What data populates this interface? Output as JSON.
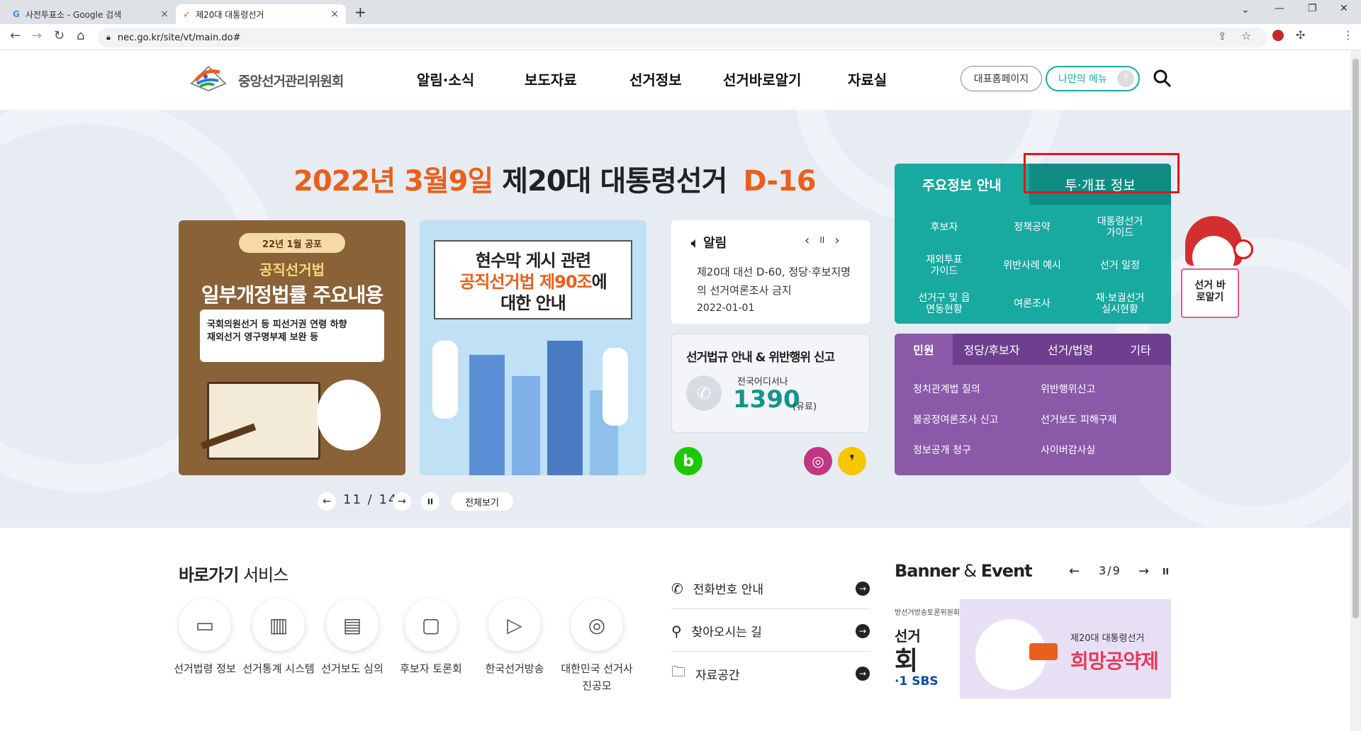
{
  "browser": {
    "tabs": [
      {
        "title": "사전투표소 - Google 검색",
        "favicon": "G",
        "close": "×"
      },
      {
        "title": "제20대 대통령선거",
        "favicon": "nec-icon",
        "close": "×"
      }
    ],
    "new_tab": "+",
    "url": "nec.go.kr/site/vt/main.do#",
    "window_controls": [
      "⌄",
      "—",
      "❐",
      "✕"
    ]
  },
  "header": {
    "logo_text": "중앙선거관리위원회",
    "nav": [
      "알림·소식",
      "보도자료",
      "선거정보",
      "선거바로알기",
      "자료실"
    ],
    "home_button": "대표홈페이지",
    "my_menu_button": "나만의 메뉴",
    "my_menu_badge": "?"
  },
  "hero": {
    "dday_date": "2022년 3월9일",
    "dday_title": "제20대 대통령선거",
    "dday_count": "D-16",
    "banner1": {
      "badge": "22년 1월 공포",
      "subtitle": "공직선거법",
      "title": "일부개정법률 주요내용",
      "box_line1": "국회의원선거 등 피선거권 연령 하향",
      "box_line2": "재외선거 영구명부제 보완 등"
    },
    "banner2": {
      "line1": "현수막 게시 관련",
      "line2": "공직선거법 제90조",
      "line2_suffix": "에",
      "line3": "대한 안내"
    },
    "pager": {
      "current": "11",
      "sep": "/",
      "total": "14",
      "prev": "←",
      "next": "→",
      "pause": "II",
      "view_all": "전체보기"
    },
    "notice": {
      "title": "알림",
      "text": "제20대 대선 D-60, 정당·후보지명의 선거여론조사 금지",
      "date": "2022-01-01",
      "prev": "‹",
      "pause": "II",
      "next": "›"
    },
    "report": {
      "title": "선거법규 안내 & 위반행위 신고",
      "caption": "전국어디서나",
      "number": "1390",
      "suffix": "(유료)"
    },
    "social": [
      "b",
      "◎",
      "❜"
    ],
    "info_panel": {
      "tab_active": "주요정보 안내",
      "tab_other": "투·개표 정보",
      "cells": [
        "후보자",
        "정책공약",
        "대통령선거 가이드",
        "재외투표 가이드",
        "위반사례 예시",
        "선거 일정",
        "선거구 및 읍면동현황",
        "여론조사",
        "재·보궐선거 실시현황"
      ]
    },
    "civil_panel": {
      "tabs": [
        "민원",
        "정당/후보자",
        "선거/법령",
        "기타"
      ],
      "links": [
        "정치관계법 질의",
        "위반행위신고",
        "불공정여론조사 신고",
        "선거보도 피해구제",
        "정보공개 청구",
        "사이버감사실"
      ]
    },
    "mascot_sign": "선거 바로알기"
  },
  "quick": {
    "title_bold": "바로가기",
    "title_rest": " 서비스",
    "items": [
      {
        "label": "선거법령 정보",
        "icon": "law-book-icon"
      },
      {
        "label": "선거통계 시스템",
        "icon": "bar-chart-icon"
      },
      {
        "label": "선거보도 심의",
        "icon": "news-icon"
      },
      {
        "label": "후보자 토론회",
        "icon": "chat-icon"
      },
      {
        "label": "한국선거방송",
        "icon": "tv-icon"
      },
      {
        "label": "대한민국 선거사진공모",
        "icon": "camera-icon"
      }
    ]
  },
  "links": [
    {
      "label": "전화번호 안내",
      "icon": "phone-icon"
    },
    {
      "label": "찾아오시는 길",
      "icon": "location-icon"
    },
    {
      "label": "자료공간",
      "icon": "folder-icon"
    }
  ],
  "banner_event": {
    "title_a": "Banner",
    "title_amp": " & ",
    "title_b": "Event",
    "current": "3",
    "sep": "/",
    "total": "9",
    "prev": "←",
    "next": "→",
    "pause": "II",
    "left_text1": "방선거방송토론위원회",
    "left_text2": "선거",
    "left_text3": "회",
    "left_text4": "·1 SBS",
    "right_text1": "제20대 대통령선거",
    "right_text2": "희망공약제"
  },
  "colors": {
    "orange": "#e8601c",
    "teal": "#18a9a0",
    "teal_dark": "#0f8c84",
    "purple": "#8a5aa8",
    "purple_dark": "#6e3f8e",
    "highlight": "#e4141b"
  }
}
